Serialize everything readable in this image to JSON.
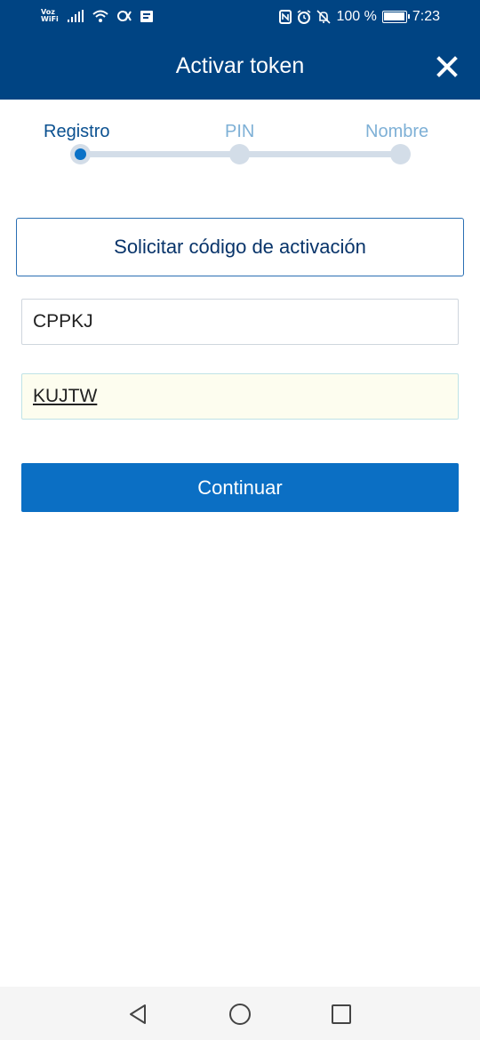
{
  "status_bar": {
    "carrier": "Voz\nWiFi",
    "battery_percent": "100 %",
    "battery_level": 1.0,
    "time": "7:23",
    "icons": [
      "signal-icon",
      "wifi-icon",
      "data-saver-icon",
      "message-icon",
      "nfc-icon",
      "alarm-icon",
      "mute-icon",
      "battery-icon"
    ]
  },
  "header": {
    "title": "Activar token",
    "close_icon": "close-icon"
  },
  "stepper": {
    "steps": [
      {
        "label": "Registro",
        "active": true
      },
      {
        "label": "PIN",
        "active": false
      },
      {
        "label": "Nombre",
        "active": false
      }
    ]
  },
  "form": {
    "request_button": "Solicitar código de activación",
    "field1_value": "CPPKJ",
    "field2_value": "KUJTW",
    "continue_button": "Continuar"
  },
  "colors": {
    "header_bg": "#004483",
    "primary": "#0b6fc4",
    "step_inactive": "#7eb0d6"
  },
  "nav_bar": {
    "icons": [
      "back-icon",
      "home-icon",
      "recents-icon"
    ]
  }
}
